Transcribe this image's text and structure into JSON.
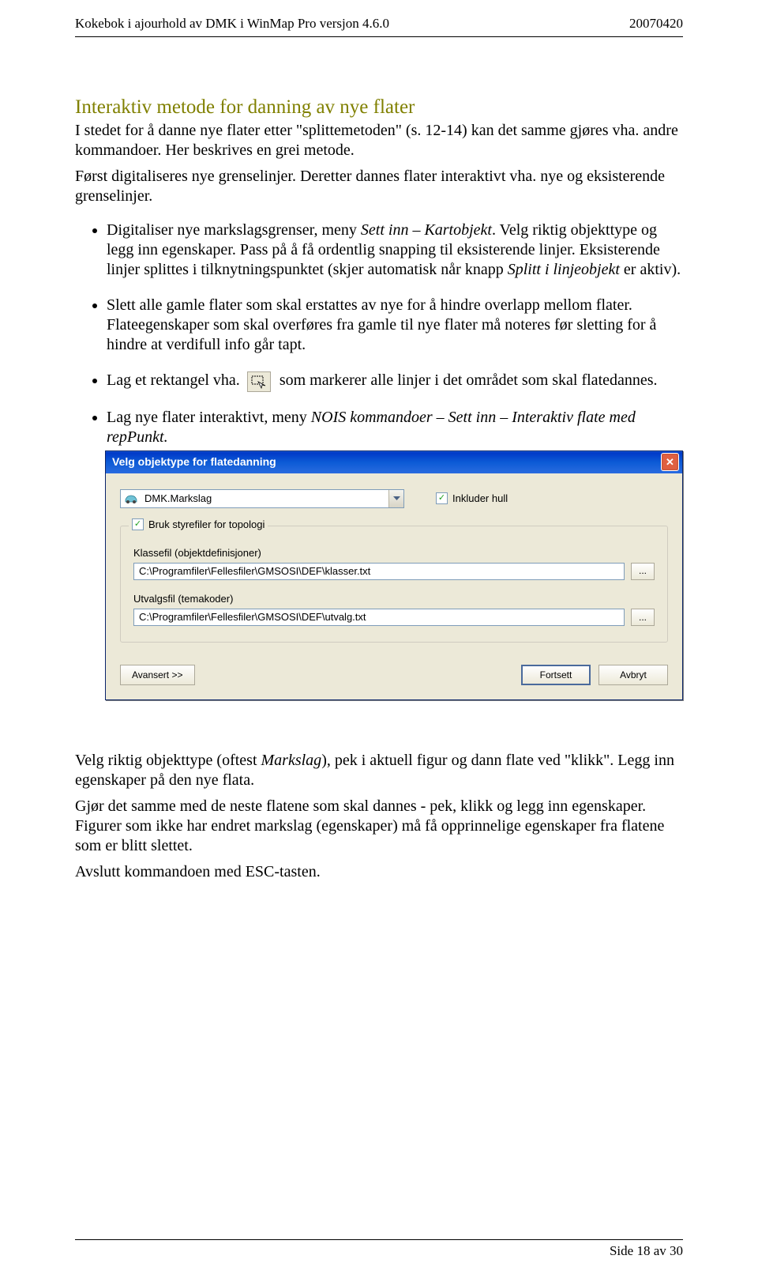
{
  "header": {
    "left": "Kokebok i ajourhold av DMK i WinMap Pro versjon 4.6.0",
    "right": "20070420"
  },
  "title": "Interaktiv metode for danning av nye flater",
  "intro": "I stedet for å danne nye flater etter \"splittemetoden\" (s. 12-14) kan det samme gjøres vha. andre kommandoer. Her beskrives en grei metode.",
  "intro2": "Først digitaliseres nye grenselinjer. Deretter dannes flater interaktivt vha. nye og eksisterende grenselinjer.",
  "bullet1a": "Digitaliser nye markslagsgrenser, meny ",
  "bullet1b_italic": "Sett inn – Kartobjekt",
  "bullet1c": ". Velg riktig objekttype og legg inn egenskaper. Pass på å få ordentlig snapping til eksisterende linjer. Eksisterende linjer splittes i tilknytningspunktet (skjer automatisk når knapp ",
  "bullet1d_italic": "Splitt i linjeobjekt",
  "bullet1e": " er aktiv).",
  "bullet2": "Slett alle gamle flater som skal erstattes av nye for å hindre overlapp mellom flater. Flateegenskaper som skal overføres fra gamle til nye flater må noteres før sletting for å hindre at verdifull info går tapt.",
  "bullet3a": "Lag et rektangel vha. ",
  "bullet3b": " som markerer alle linjer i det området som skal flatedannes.",
  "bullet4a": "Lag nye flater interaktivt, meny ",
  "bullet4b_italic": "NOIS kommandoer – Sett inn – Interaktiv flate med repPunkt.",
  "dialog": {
    "title": "Velg objektype for flatedanning",
    "combo_value": "DMK.Markslag",
    "include_holes": "Inkluder hull",
    "group_legend": "Bruk styrefiler for topologi",
    "klassefil_label": "Klassefil (objektdefinisjoner)",
    "klassefil_value": "C:\\Programfiler\\Fellesfiler\\GMSOSI\\DEF\\klasser.txt",
    "utvalg_label": "Utvalgsfil (temakoder)",
    "utvalg_value": "C:\\Programfiler\\Fellesfiler\\GMSOSI\\DEF\\utvalg.txt",
    "browse": "...",
    "advanced": "Avansert >>",
    "continue": "Fortsett",
    "cancel": "Avbryt"
  },
  "after1a": "Velg riktig objekttype (oftest ",
  "after1b_italic": "Markslag",
  "after1c": "), pek i aktuell figur og dann flate ved \"klikk\". Legg inn egenskaper på den nye flata.",
  "after2": "Gjør det samme med de neste flatene som skal dannes - pek, klikk og legg inn egenskaper. Figurer som ikke har endret markslag (egenskaper) må få opprinnelige egenskaper fra flatene som er blitt slettet.",
  "after3": "Avslutt kommandoen med ESC-tasten.",
  "footer": "Side 18 av 30"
}
